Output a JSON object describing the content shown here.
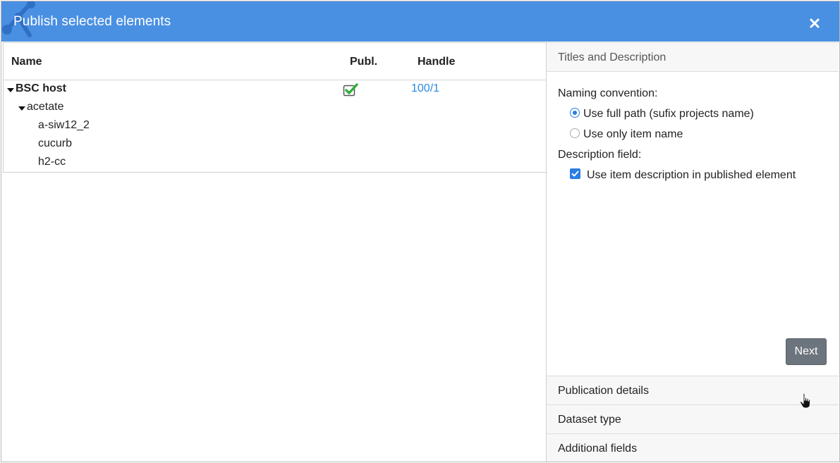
{
  "dialog": {
    "title": "Publish selected elements",
    "close_icon": "close-icon",
    "accent": "#4a90e2"
  },
  "table": {
    "columns": {
      "name": "Name",
      "publ": "Publ.",
      "handle": "Handle"
    },
    "rows": [
      {
        "name": "BSC host",
        "level": 0,
        "expanded": true,
        "bold": true,
        "published": true,
        "handle": "100/1"
      },
      {
        "name": "acetate",
        "level": 1,
        "expanded": true,
        "bold": false,
        "published": false,
        "handle": ""
      },
      {
        "name": "a-siw12_2",
        "level": 2,
        "expanded": false,
        "bold": false,
        "published": false,
        "handle": ""
      },
      {
        "name": "cucurb",
        "level": 2,
        "expanded": false,
        "bold": false,
        "published": false,
        "handle": ""
      },
      {
        "name": "h2-cc",
        "level": 2,
        "expanded": false,
        "bold": false,
        "published": false,
        "handle": ""
      }
    ]
  },
  "accordion": {
    "sections": [
      {
        "label": "Titles and Description"
      },
      {
        "label": "Publication details"
      },
      {
        "label": "Dataset type"
      },
      {
        "label": "Additional fields"
      }
    ],
    "titles": {
      "naming_label": "Naming convention:",
      "option_full_path": "Use full path (sufix projects name)",
      "option_item_name": "Use only item name",
      "selected_naming": "Use full path (sufix projects name)",
      "description_label": "Description field:",
      "use_description_label": "Use item description in published element",
      "use_description_checked": true,
      "next_label": "Next"
    }
  }
}
